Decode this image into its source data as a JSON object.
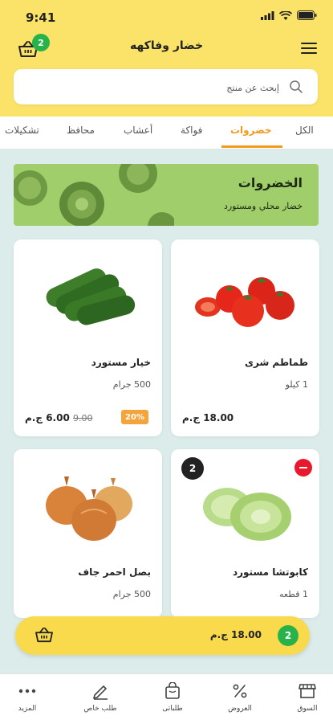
{
  "status": {
    "time": "9:41"
  },
  "header": {
    "title": "خضار وفاكهه",
    "cart_count": "2"
  },
  "search": {
    "placeholder": "إبحث عن منتج",
    "value": ""
  },
  "tabs": [
    {
      "label": "الكل"
    },
    {
      "label": "خضروات",
      "active": true
    },
    {
      "label": "فواكة"
    },
    {
      "label": "أعشاب"
    },
    {
      "label": "محافظ"
    },
    {
      "label": "تشكيلات"
    }
  ],
  "banner": {
    "title": "الخضروات",
    "subtitle": "خضار محلي ومستورد"
  },
  "products": [
    {
      "name": "طماطم شرى",
      "qty": "1 كيلو",
      "price": "18.00 ج.م"
    },
    {
      "name": "خيار مستورد",
      "qty": "500 جرام",
      "price": "6.00 ج.م",
      "old_price": "9.00",
      "discount": "20%"
    },
    {
      "name": "كابوتشا مستورد",
      "qty": "1 قطعه",
      "cart_qty": "2"
    },
    {
      "name": "بصل احمر جاف",
      "qty": "500 جرام"
    }
  ],
  "cart_bar": {
    "count": "2",
    "total": "18.00 ج.م"
  },
  "bottom_nav": [
    {
      "label": "السوق",
      "icon": "store-icon"
    },
    {
      "label": "العروض",
      "icon": "percent-icon"
    },
    {
      "label": "طلباتى",
      "icon": "shopping-bag-icon"
    },
    {
      "label": "طلب خاص",
      "icon": "pencil-icon"
    },
    {
      "label": "المزيد",
      "icon": "more-icon"
    }
  ],
  "colors": {
    "header": "#fbe36a",
    "accent": "#f29a1e",
    "green": "#28b34a",
    "cart_bar": "#f9da4c"
  }
}
